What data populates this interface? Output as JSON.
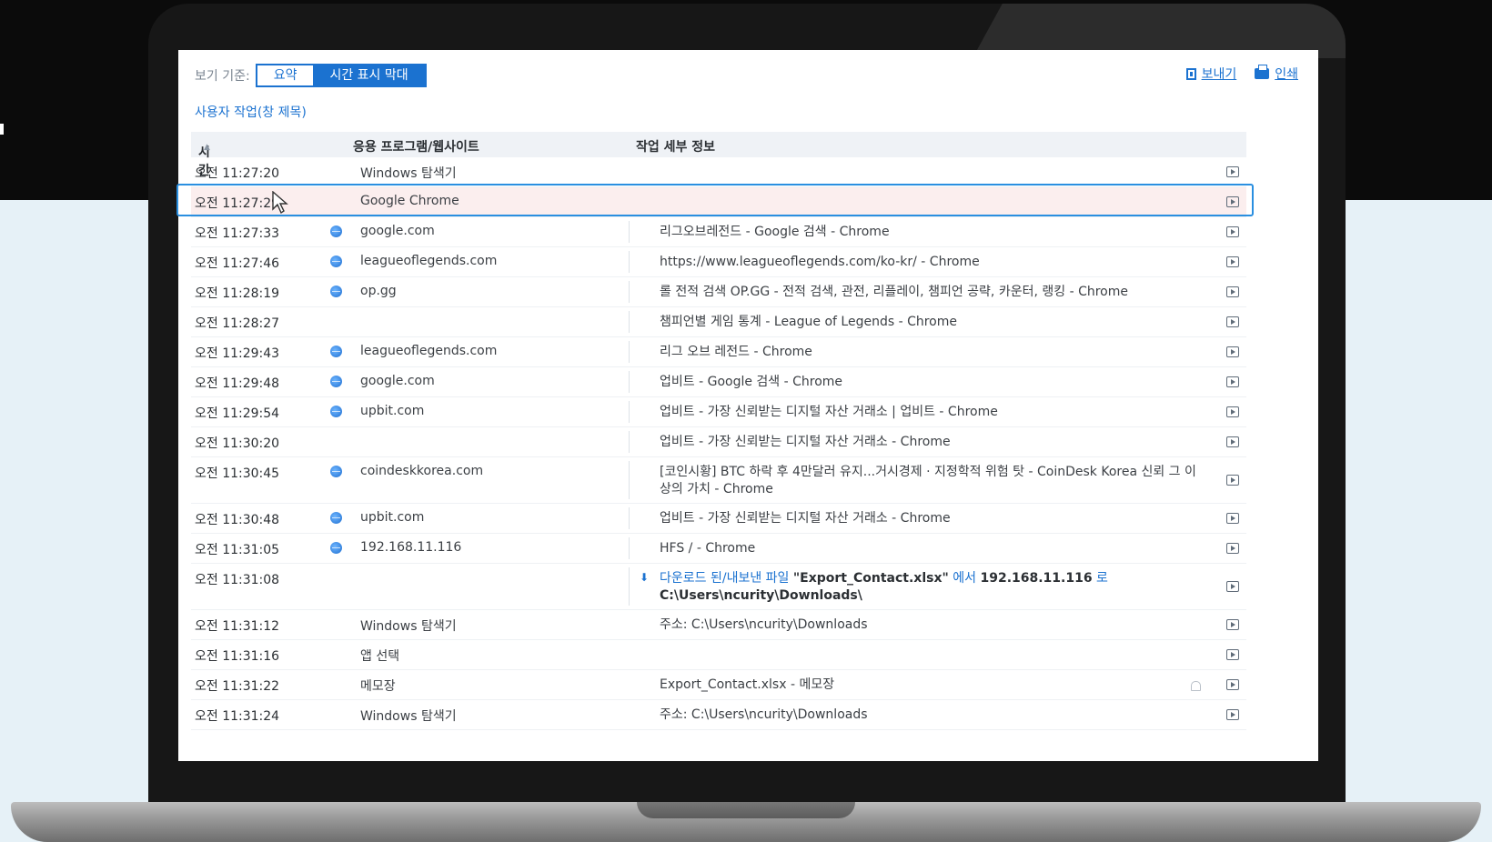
{
  "view": {
    "label": "보기 기준:",
    "options": [
      "요약",
      "시간 표시 막대"
    ],
    "active_option": "시간 표시 막대"
  },
  "actions": {
    "export_label": "보내기",
    "print_label": "인쇄"
  },
  "section_title": "사용자 작업(창 제목)",
  "columns": {
    "time": "시간",
    "app": "응용 프로그램/웹사이트",
    "detail": "작업 세부 정보"
  },
  "rows": [
    {
      "time": "오전 11:27:20",
      "app": "Windows 탐색기",
      "detail": "",
      "web": false
    },
    {
      "time": "오전 11:27:29",
      "app": "Google Chrome",
      "detail": "",
      "web": false,
      "selected": true
    },
    {
      "time": "오전 11:27:33",
      "app": "google.com",
      "detail": "리그오브레전드 - Google 검색 - Chrome",
      "web": true
    },
    {
      "time": "오전 11:27:46",
      "app": "leagueoflegends.com",
      "detail": "https://www.leagueoflegends.com/ko-kr/ - Chrome",
      "web": true
    },
    {
      "time": "오전 11:28:19",
      "app": "op.gg",
      "detail": "롤 전적 검색 OP.GG - 전적 검색, 관전, 리플레이, 챔피언 공략, 카운터, 랭킹 - Chrome",
      "web": true
    },
    {
      "time": "오전 11:28:27",
      "app": "",
      "detail": "챔피언별 게임 통계 - League of Legends - Chrome",
      "web": false
    },
    {
      "time": "오전 11:29:43",
      "app": "leagueoflegends.com",
      "detail": "리그 오브 레전드 - Chrome",
      "web": true
    },
    {
      "time": "오전 11:29:48",
      "app": "google.com",
      "detail": "업비트 - Google 검색 - Chrome",
      "web": true
    },
    {
      "time": "오전 11:29:54",
      "app": "upbit.com",
      "detail": "업비트 - 가장 신뢰받는 디지털 자산 거래소 | 업비트 - Chrome",
      "web": true
    },
    {
      "time": "오전 11:30:20",
      "app": "",
      "detail": "업비트 - 가장 신뢰받는 디지털 자산 거래소 - Chrome",
      "web": false
    },
    {
      "time": "오전 11:30:45",
      "app": "coindeskkorea.com",
      "detail": "[코인시황] BTC 하락 후 4만달러 유지...거시경제 · 지정학적 위험 탓 - CoinDesk Korea 신뢰 그 이상의 가치 - Chrome",
      "web": true
    },
    {
      "time": "오전 11:30:48",
      "app": "upbit.com",
      "detail": "업비트 - 가장 신뢰받는 디지털 자산 거래소 - Chrome",
      "web": true
    },
    {
      "time": "오전 11:31:05",
      "app": "192.168.11.116",
      "detail": "HFS / - Chrome",
      "web": true
    },
    {
      "time": "오전 11:31:08",
      "app": "",
      "detail": "",
      "web": false,
      "download": true
    },
    {
      "time": "오전 11:31:12",
      "app": "Windows 탐색기",
      "detail": "주소: C:\\Users\\ncurity\\Downloads",
      "web": false
    },
    {
      "time": "오전 11:31:16",
      "app": "앱 선택",
      "detail": "",
      "web": false
    },
    {
      "time": "오전 11:31:22",
      "app": "메모장",
      "detail": "Export_Contact.xlsx - 메모장",
      "web": false,
      "bell": true
    },
    {
      "time": "오전 11:31:24",
      "app": "Windows 탐색기",
      "detail": "주소: C:\\Users\\ncurity\\Downloads",
      "web": false
    }
  ],
  "download_detail": {
    "prefix": "다운로드 된/내보낸 파일",
    "file": "\"Export_Contact.xlsx\"",
    "mid": "에서",
    "source": "192.168.11.116",
    "suffix": "로",
    "path": "C:\\Users\\ncurity\\Downloads\\"
  },
  "colors": {
    "accent": "#1b72d0",
    "selection_border": "#2a8fe0",
    "selection_bg": "#fbeeee"
  }
}
